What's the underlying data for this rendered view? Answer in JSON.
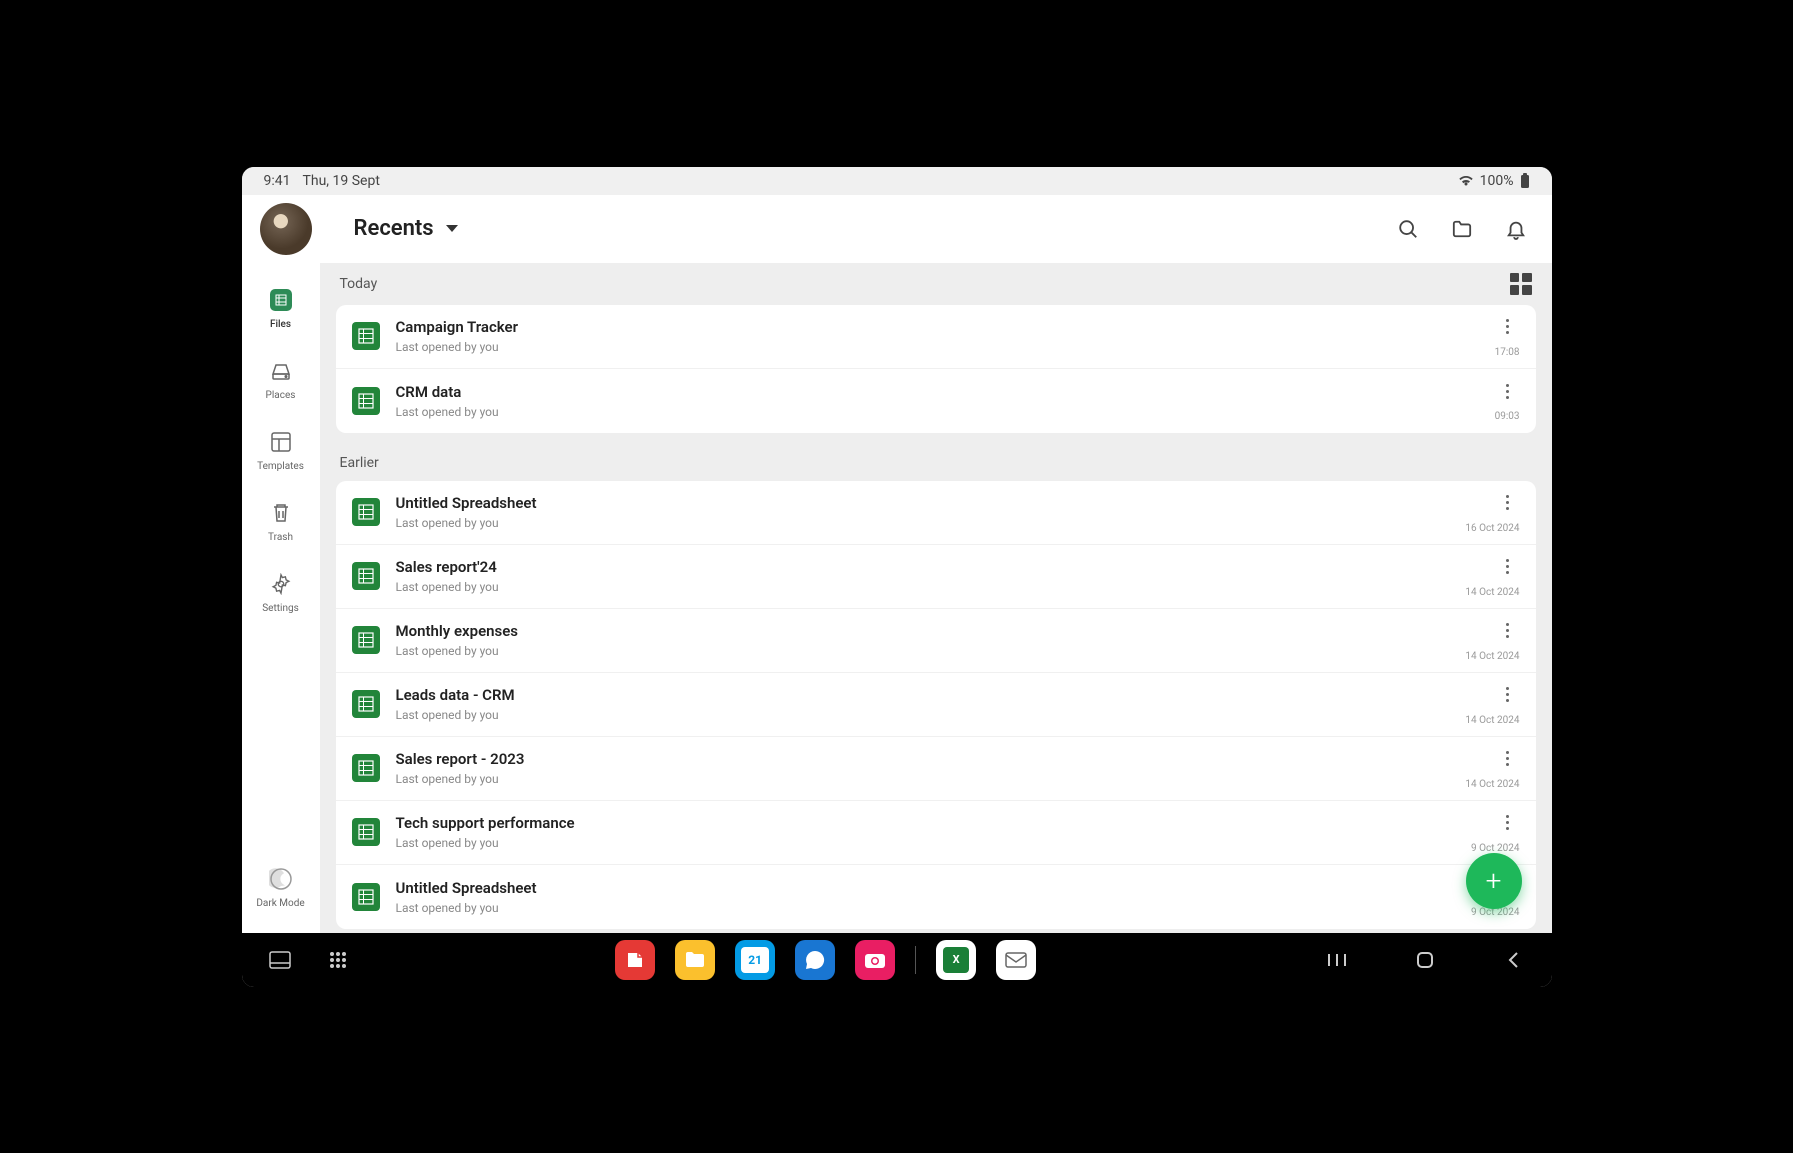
{
  "status": {
    "time": "9:41",
    "date": "Thu, 19 Sept",
    "battery": "100%"
  },
  "header": {
    "title": "Recents"
  },
  "sidebar": {
    "items": [
      {
        "label": "Files"
      },
      {
        "label": "Places"
      },
      {
        "label": "Templates"
      },
      {
        "label": "Trash"
      },
      {
        "label": "Settings"
      },
      {
        "label": "Dark Mode"
      }
    ]
  },
  "sections": [
    {
      "title": "Today",
      "files": [
        {
          "title": "Campaign Tracker",
          "sub_prefix": "Last opened by ",
          "sub_actor": "you",
          "date": "17:08"
        },
        {
          "title": "CRM data",
          "sub_prefix": "Last opened by ",
          "sub_actor": "you",
          "date": "09:03"
        }
      ]
    },
    {
      "title": "Earlier",
      "files": [
        {
          "title": "Untitled Spreadsheet",
          "sub_prefix": "Last opened by ",
          "sub_actor": "you",
          "date": "16 Oct 2024"
        },
        {
          "title": "Sales report'24",
          "sub_prefix": "Last opened by ",
          "sub_actor": "you",
          "date": "14 Oct 2024"
        },
        {
          "title": "Monthly expenses",
          "sub_prefix": "Last opened by ",
          "sub_actor": "you",
          "date": "14 Oct 2024"
        },
        {
          "title": "Leads data - CRM",
          "sub_prefix": "Last opened by ",
          "sub_actor": "you",
          "date": "14 Oct 2024"
        },
        {
          "title": "Sales report - 2023",
          "sub_prefix": "Last opened by ",
          "sub_actor": "you",
          "date": "14 Oct 2024"
        },
        {
          "title": "Tech support performance",
          "sub_prefix": "Last opened by ",
          "sub_actor": "you",
          "date": "9 Oct 2024"
        },
        {
          "title": "Untitled Spreadsheet",
          "sub_prefix": "Last opened by ",
          "sub_actor": "you",
          "date": "9 Oct 2024"
        }
      ]
    }
  ],
  "dock": {
    "calendar_day": "21"
  }
}
